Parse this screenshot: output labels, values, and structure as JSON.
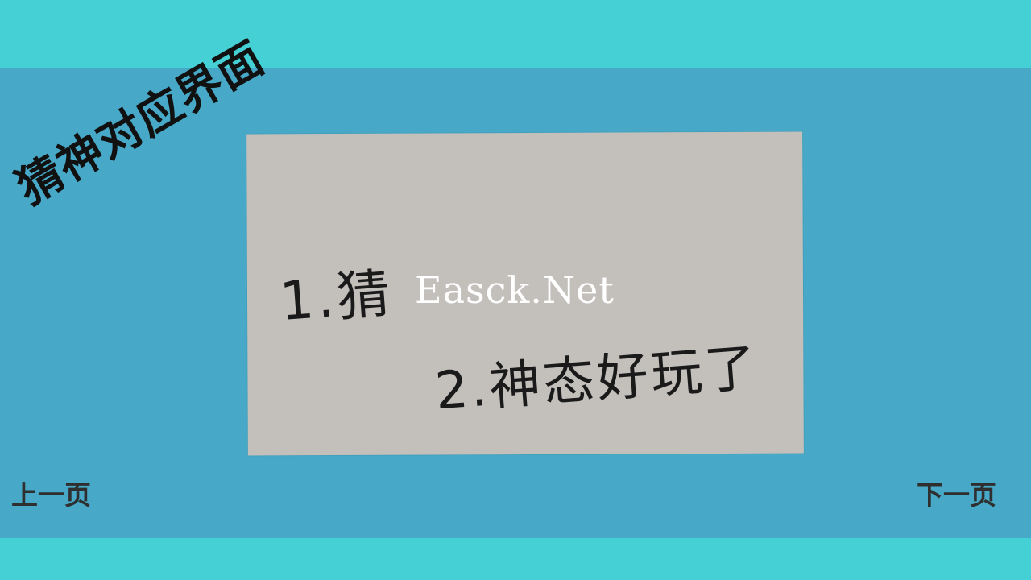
{
  "title": "猜神对应界面",
  "photo": {
    "line1": "1.猜",
    "line2": "2.神态好玩了"
  },
  "watermark": "Easck.Net",
  "nav": {
    "prev": "上一页",
    "next": "下一页"
  },
  "colors": {
    "band": "#44d0d4",
    "stage": "#47a9c7",
    "paper": "#c3c0bc",
    "text": "#111111"
  }
}
